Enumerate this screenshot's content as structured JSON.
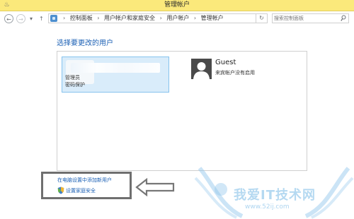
{
  "window": {
    "title": "管理帐户"
  },
  "addressbar": {
    "back_glyph": "←",
    "forward_glyph": "→",
    "dropdown_glyph": "▾",
    "up_glyph": "↑",
    "breadcrumbs": [
      "控制面板",
      "用户帐户和家庭安全",
      "用户帐户",
      "管理帐户"
    ],
    "separator": "›",
    "refresh_glyph": "↻",
    "search_placeholder": "搜索控制面板"
  },
  "main": {
    "heading": "选择要更改的用户",
    "users": [
      {
        "name": "",
        "lines": [
          "管理员",
          "密码保护"
        ],
        "selected": true
      },
      {
        "name": "Guest",
        "lines": [
          "来宾帐户没有启用"
        ],
        "selected": false
      }
    ],
    "links": {
      "add_user": "在电脑设置中添加新用户",
      "family_safety": "设置家庭安全"
    }
  },
  "watermark": {
    "text": "我爱IT技术网",
    "url": "www.52ij.com"
  },
  "colors": {
    "titlebar": "#fbe97b",
    "link": "#1a5fb4",
    "selection": "#d9ecfa",
    "selection_border": "#86c3ee"
  },
  "icons": {
    "app": "control-panel-icon",
    "path": "control-panel-icon",
    "search": "search-icon",
    "guest_avatar": "user-silhouette-icon",
    "family_link": "shield-icon",
    "annotation": "arrow-left-icon"
  }
}
